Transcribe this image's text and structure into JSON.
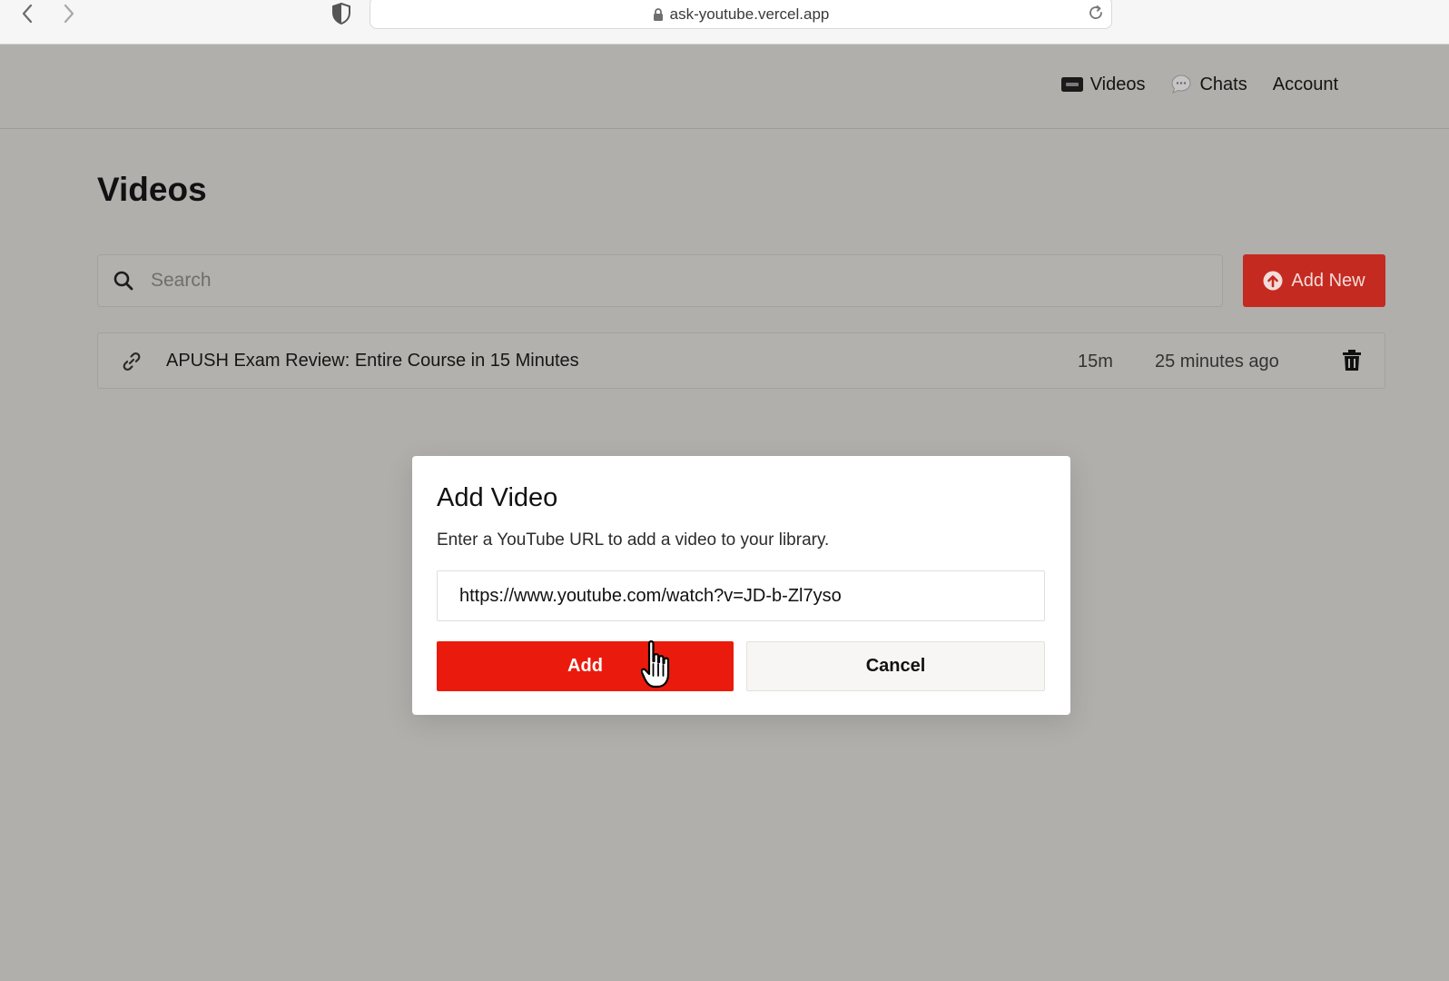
{
  "browser": {
    "url": "ask-youtube.vercel.app"
  },
  "nav": {
    "items": [
      {
        "label": "Videos",
        "icon": "video-icon"
      },
      {
        "label": "Chats",
        "icon": "chat-bubble-icon"
      },
      {
        "label": "Account"
      }
    ]
  },
  "page": {
    "title": "Videos"
  },
  "search": {
    "placeholder": "Search",
    "value": ""
  },
  "toolbar": {
    "add_new_label": "Add New"
  },
  "videos": [
    {
      "title": "APUSH Exam Review: Entire Course in 15 Minutes",
      "duration": "15m",
      "added": "25 minutes ago"
    }
  ],
  "modal": {
    "title": "Add Video",
    "description": "Enter a YouTube URL to add a video to your library.",
    "url_value": "https://www.youtube.com/watch?v=JD-b-Zl7yso",
    "add_label": "Add",
    "cancel_label": "Cancel"
  },
  "colors": {
    "overlay_bg": "#b0afac",
    "accent": "#ea1b0c",
    "accent_dim": "#c52a21"
  }
}
